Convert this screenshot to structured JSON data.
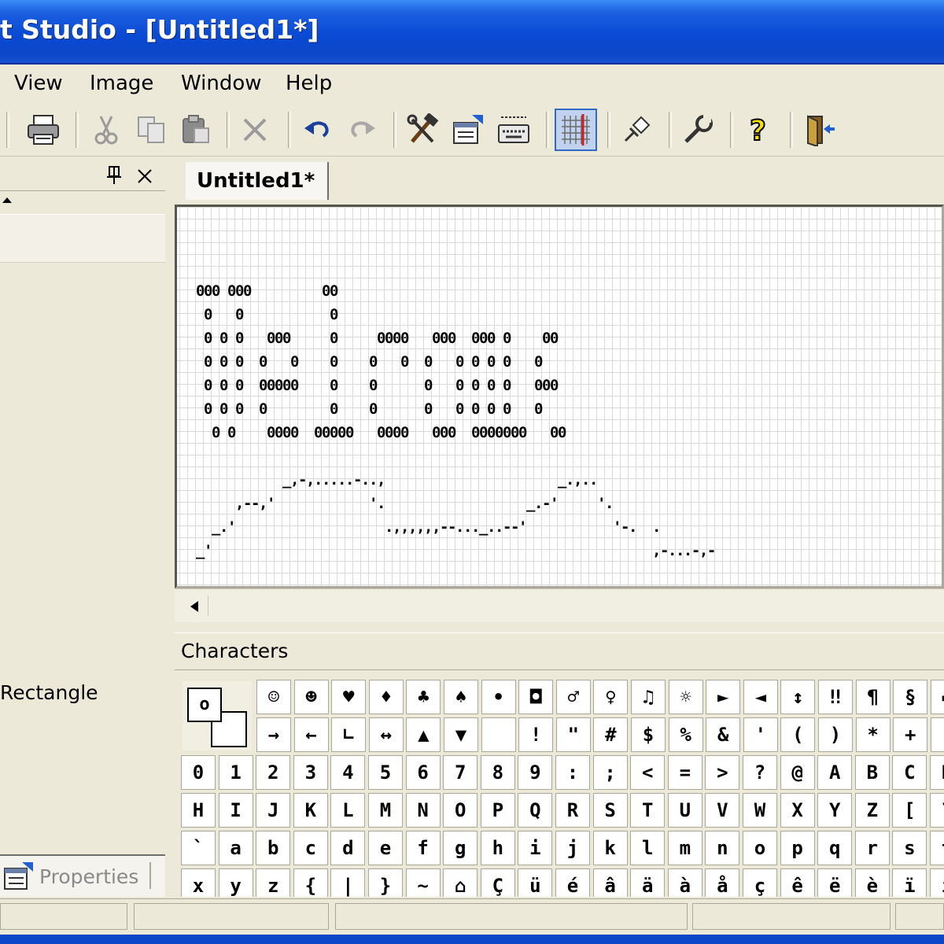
{
  "window": {
    "title": "t Studio - [Untitled1*]"
  },
  "menu": [
    "View",
    "Image",
    "Window",
    "Help"
  ],
  "toolbar": {
    "buttons": [
      "print-icon",
      "cut-icon",
      "copy-icon",
      "paste-icon",
      "delete-icon",
      "undo-icon",
      "redo-icon",
      "tools-icon",
      "properties-icon",
      "keyboard-icon",
      "grid-icon",
      "pin-icon",
      "settings-icon",
      "help-icon",
      "exit-icon"
    ],
    "active": "grid-icon"
  },
  "left_pane": {
    "pin_glyph": "❤",
    "close_glyph": "✕",
    "rectangle_label": "Rectangle",
    "properties_tab_label": "Properties"
  },
  "document": {
    "tab_label": "Untitled1*",
    "ascii_lines": [
      "000 000         00",
      " 0   0           0",
      " 0 0 0   000     0     0000   000  000 0    00",
      " 0 0 0  0   0    0    0   0  0   0 0 0 0   0",
      " 0 0 0  00000    0    0      0   0 0 0 0   000",
      " 0 0 0  0        0    0      0   0 0 0 0   0",
      "  0 0    0000  00000   0000   000  0000000   00",
      "",
      "           _,-,.....-..,                      _.,..",
      "     ,--,'            '.                  _.-'     '.",
      "  _.'                   .,,,,,,--..._..--'           '-.  .",
      "_'                                                        ,-...-,-"
    ]
  },
  "characters": {
    "header": "Characters",
    "preview_char": "o",
    "rows": [
      [
        "☺",
        "☻",
        "♥",
        "♦",
        "♣",
        "♠",
        "•",
        "◘",
        "♂",
        "♀",
        "♫",
        "☼",
        "►",
        "◄",
        "↕",
        "‼",
        "¶",
        "§",
        "▬"
      ],
      [
        "→",
        "←",
        "∟",
        "↔",
        "▲",
        "▼",
        " ",
        "!",
        "\"",
        "#",
        "$",
        "%",
        "&",
        "'",
        "(",
        ")",
        "*",
        "+",
        ","
      ],
      [
        "0",
        "1",
        "2",
        "3",
        "4",
        "5",
        "6",
        "7",
        "8",
        "9",
        ":",
        ";",
        "<",
        "=",
        ">",
        "?",
        "@",
        "A",
        "B",
        "C",
        "D"
      ],
      [
        "H",
        "I",
        "J",
        "K",
        "L",
        "M",
        "N",
        "O",
        "P",
        "Q",
        "R",
        "S",
        "T",
        "U",
        "V",
        "W",
        "X",
        "Y",
        "Z",
        "[",
        "\\"
      ],
      [
        "`",
        "a",
        "b",
        "c",
        "d",
        "e",
        "f",
        "g",
        "h",
        "i",
        "j",
        "k",
        "l",
        "m",
        "n",
        "o",
        "p",
        "q",
        "r",
        "s",
        "t"
      ],
      [
        "x",
        "y",
        "z",
        "{",
        "|",
        "}",
        "~",
        "⌂",
        "Ç",
        "ü",
        "é",
        "â",
        "ä",
        "à",
        "å",
        "ç",
        "ê",
        "ë",
        "è",
        "ï",
        "î"
      ]
    ]
  }
}
